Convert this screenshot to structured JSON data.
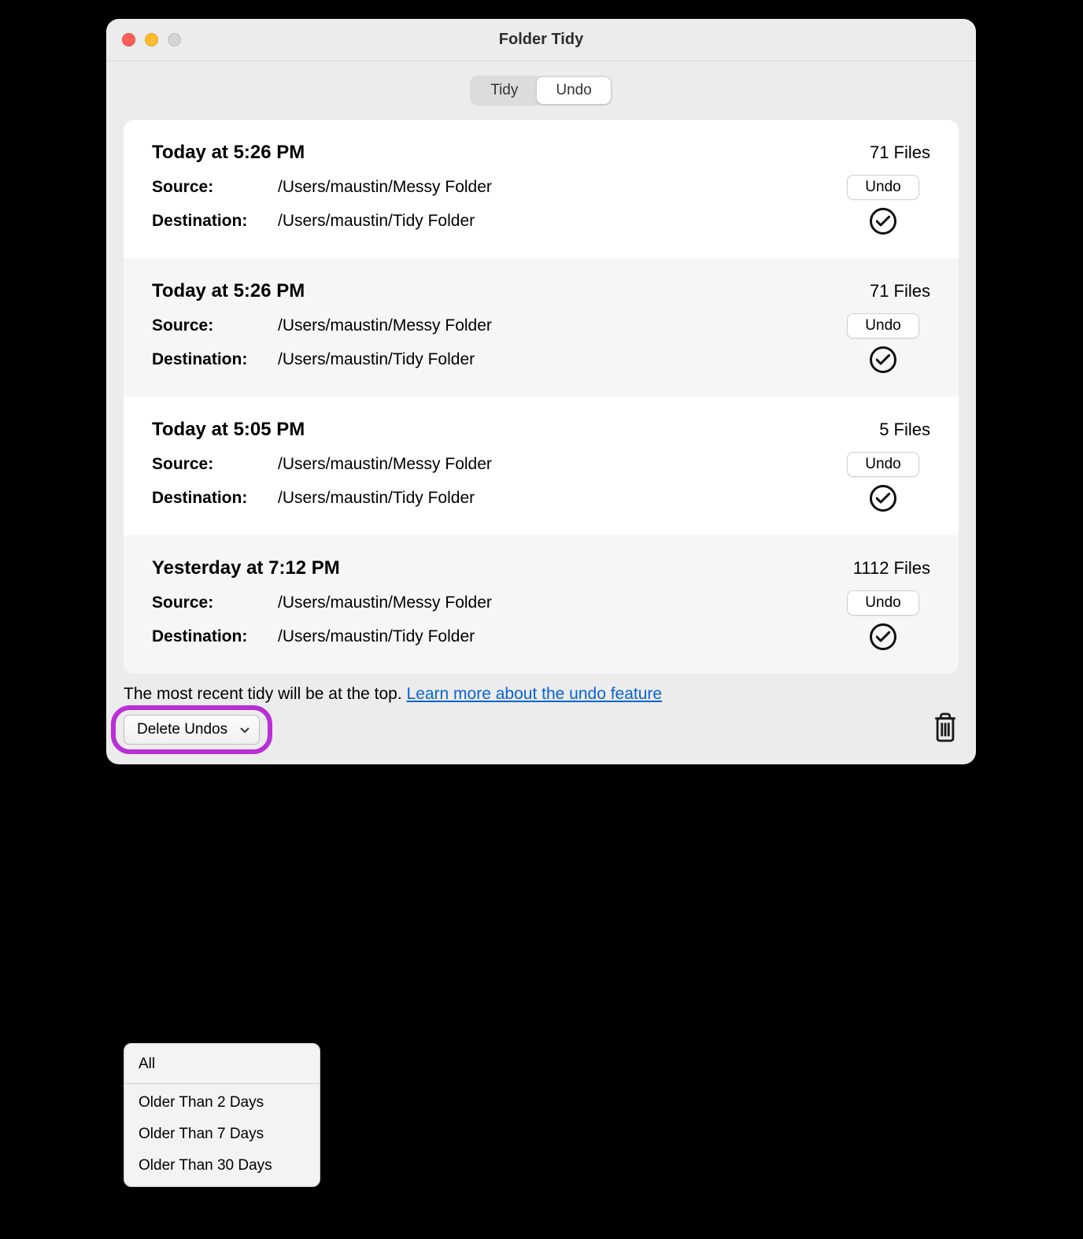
{
  "window_title": "Folder Tidy",
  "tabs": {
    "tidy": "Tidy",
    "undo": "Undo"
  },
  "labels": {
    "source": "Source:",
    "destination": "Destination:"
  },
  "undo_button_label": "Undo",
  "entries": [
    {
      "time": "Today at 5:26 PM",
      "files": "71 Files",
      "source": "/Users/maustin/Messy Folder",
      "destination": "/Users/maustin/Tidy Folder"
    },
    {
      "time": "Today at 5:26 PM",
      "files": "71 Files",
      "source": "/Users/maustin/Messy Folder",
      "destination": "/Users/maustin/Tidy Folder"
    },
    {
      "time": "Today at 5:05 PM",
      "files": "5 Files",
      "source": "/Users/maustin/Messy Folder",
      "destination": "/Users/maustin/Tidy Folder"
    },
    {
      "time": "Yesterday at 7:12 PM",
      "files": "1112 Files",
      "source": "/Users/maustin/Messy Folder",
      "destination": "/Users/maustin/Tidy Folder"
    }
  ],
  "footer": {
    "text": "The most recent tidy will be at the top.  ",
    "link": "Learn more about the undo feature"
  },
  "delete_select": {
    "label": "Delete Undos",
    "options": [
      "All",
      "Older Than 2 Days",
      "Older Than 7 Days",
      "Older Than 30 Days"
    ]
  }
}
